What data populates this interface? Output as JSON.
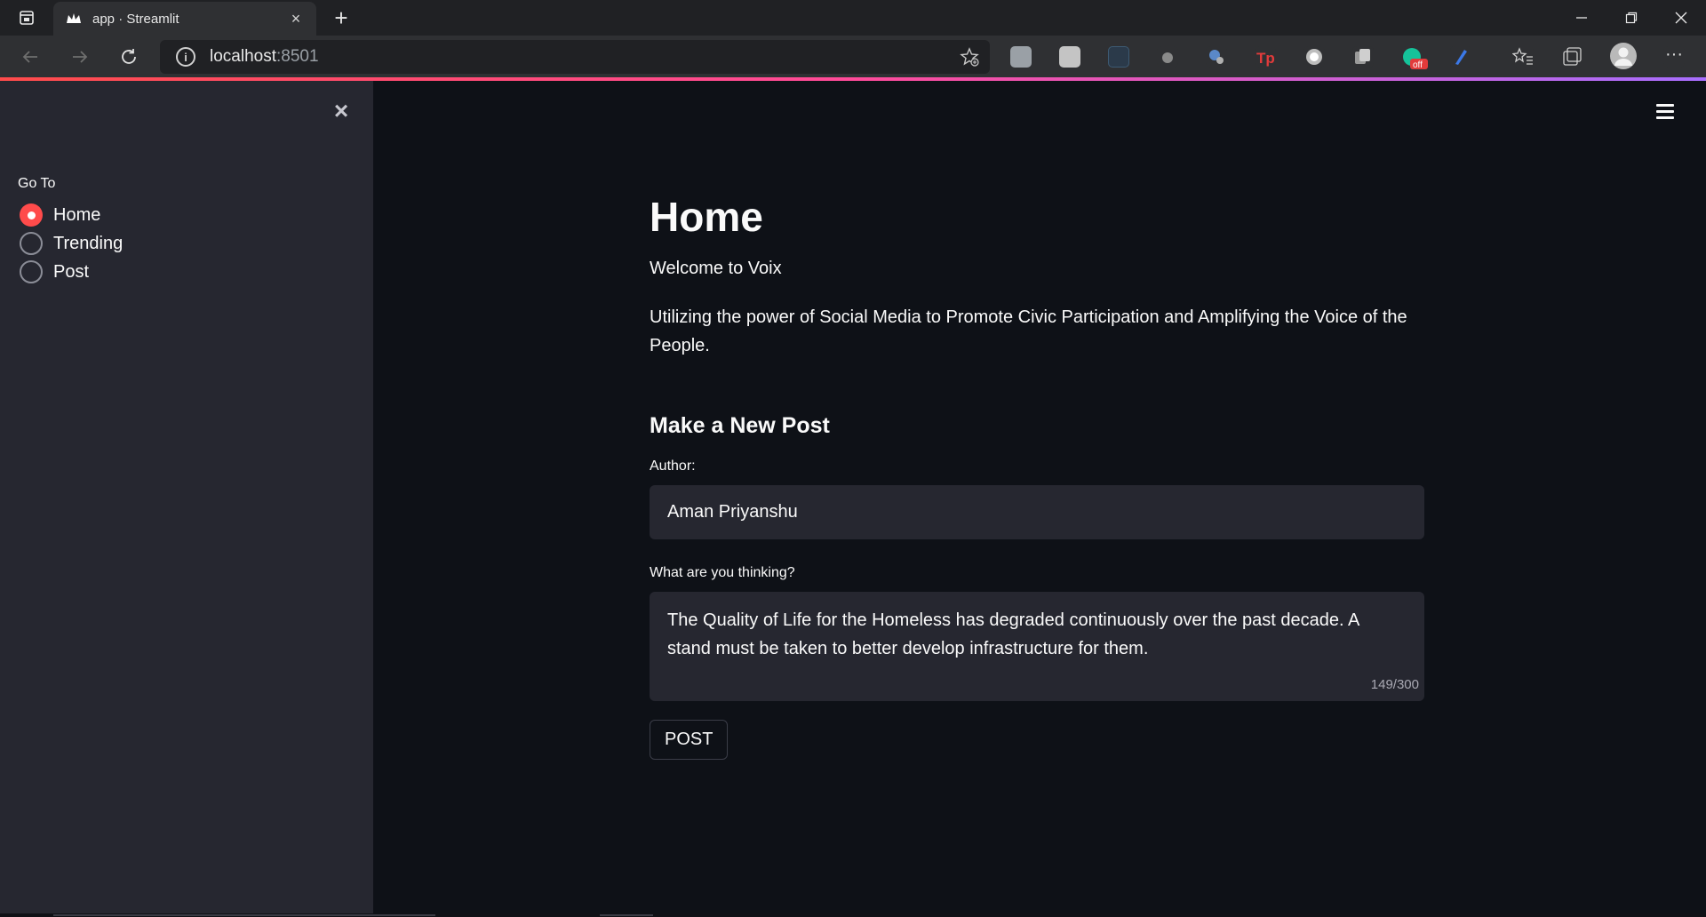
{
  "browser": {
    "tab_title": "app · Streamlit",
    "new_tab": "+",
    "url_host": "localhost",
    "url_port": ":8501"
  },
  "sidebar": {
    "close": "×",
    "radio_label": "Go To",
    "options": [
      {
        "label": "Home",
        "selected": true
      },
      {
        "label": "Trending",
        "selected": false
      },
      {
        "label": "Post",
        "selected": false
      }
    ]
  },
  "main": {
    "title": "Home",
    "welcome": "Welcome to Voix",
    "tagline": "Utilizing the power of Social Media to Promote Civic Participation and Amplifying the Voice of the People.",
    "form_heading": "Make a New Post",
    "author_label": "Author:",
    "author_value": "Aman Priyanshu",
    "thinking_label": "What are you thinking?",
    "thinking_value": "The Quality of Life for the Homeless has degraded continuously over the past decade. A stand must be taken to better develop infrastructure for them.",
    "char_count": "149/300",
    "post_button": "POST"
  },
  "colors": {
    "accent": "#ff4b4b",
    "sidebar_bg": "#262730",
    "main_bg": "#0e1117"
  }
}
